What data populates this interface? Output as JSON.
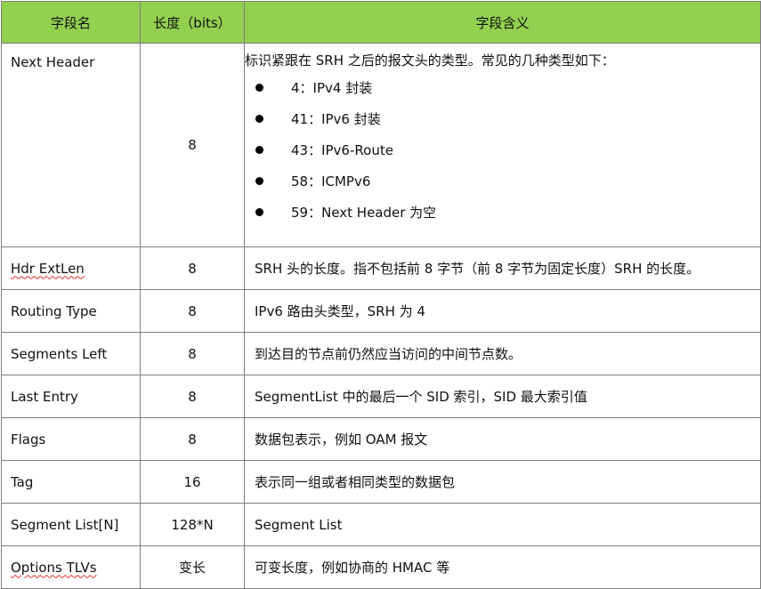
{
  "headers": [
    "字段名",
    "长度（bits）",
    "字段含义"
  ],
  "rows": [
    {
      "name": "Next Header",
      "length": "8",
      "meaning": "标识紧跟在 SRH 之后的报文头的类型。常见的几种类型如下：",
      "bullets": [
        "4：IPv4 封装",
        "41：IPv6 封装",
        "43：IPv6-Route",
        "58：ICMPv6",
        "59：Next Header 为空"
      ]
    },
    {
      "name": "Hdr ExtLen",
      "length": "8",
      "meaning": "SRH 头的长度。指不包括前 8 字节（前 8 字节为固定长度）SRH 的长度。"
    },
    {
      "name": "Routing Type",
      "length": "8",
      "meaning": "IPv6 路由头类型，SRH 为 4"
    },
    {
      "name": "Segments Left",
      "length": "8",
      "meaning": "到达目的节点前仍然应当访问的中间节点数。"
    },
    {
      "name": "Last Entry",
      "length": "8",
      "meaning": "SegmentList 中的最后一个 SID 索引，SID 最大索引值"
    },
    {
      "name": "Flags",
      "length": "8",
      "meaning": "数据包表示，例如 OAM 报文"
    },
    {
      "name": "Tag",
      "length": "16",
      "meaning": "表示同一组或者相同类型的数据包"
    },
    {
      "name": "Segment List[N]",
      "length": "128*N",
      "meaning": "Segment List"
    },
    {
      "name": "Options TLVs",
      "length": "变长",
      "meaning": "可变长度，例如协商的 HMAC 等"
    }
  ]
}
